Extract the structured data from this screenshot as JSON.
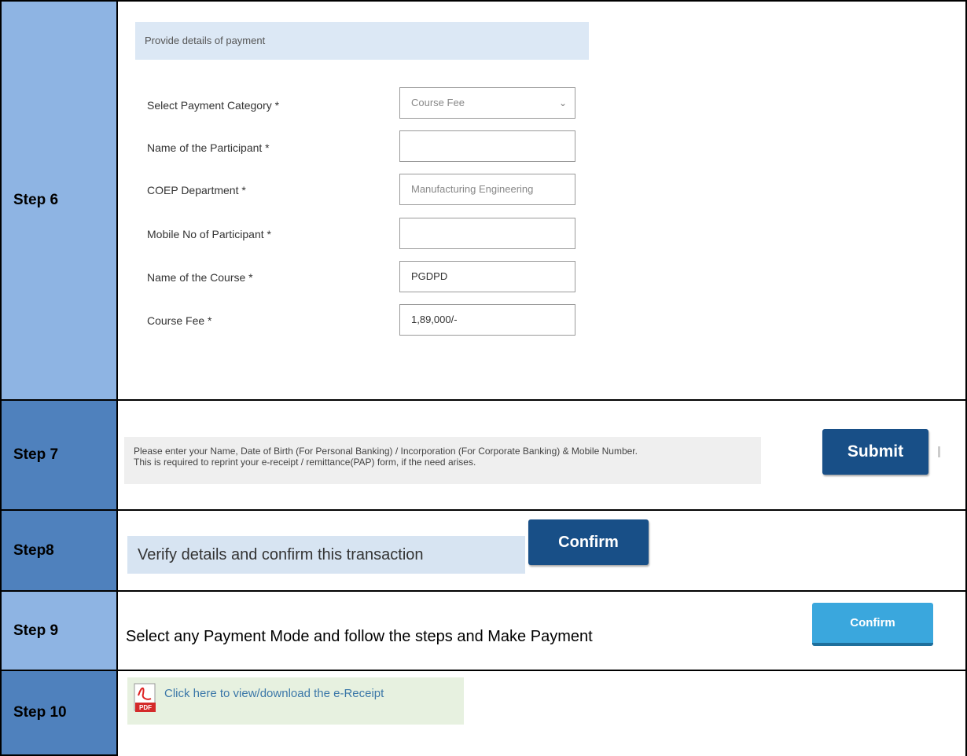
{
  "steps": {
    "s6": "Step 6",
    "s7": "Step 7",
    "s8": "Step8",
    "s9": "Step 9",
    "s10": "Step 10"
  },
  "step6": {
    "header": "Provide details of payment",
    "fields": [
      {
        "label": "Select Payment Category *",
        "value": "Course Fee",
        "type": "select"
      },
      {
        "label": "Name of the Participant *",
        "value": ""
      },
      {
        "label": "COEP Department *",
        "value": "Manufacturing Engineering"
      },
      {
        "label": "Mobile No of Participant *",
        "value": ""
      },
      {
        "label": "Name of the Course *",
        "value": "PGDPD"
      },
      {
        "label": "Course Fee *",
        "value": "1,89,000/-"
      }
    ]
  },
  "step7": {
    "line1": "Please enter your Name, Date of Birth (For Personal Banking) / Incorporation (For Corporate Banking) & Mobile Number.",
    "line2": "This is required to reprint your e-receipt / remittance(PAP) form, if the need arises.",
    "button": "Submit"
  },
  "step8": {
    "text": "Verify details and confirm this transaction",
    "button": "Confirm"
  },
  "step9": {
    "text": "Select any Payment Mode and follow the steps and Make Payment",
    "button": "Confirm"
  },
  "step10": {
    "link": "Click here to view/download the e-Receipt",
    "icon": "pdf-icon",
    "icon_text": "PDF"
  },
  "colors": {
    "step_light": "#8eb4e3",
    "step_dark": "#4f81bd",
    "button_dark": "#184f87",
    "button_light": "#3aa7dd"
  }
}
